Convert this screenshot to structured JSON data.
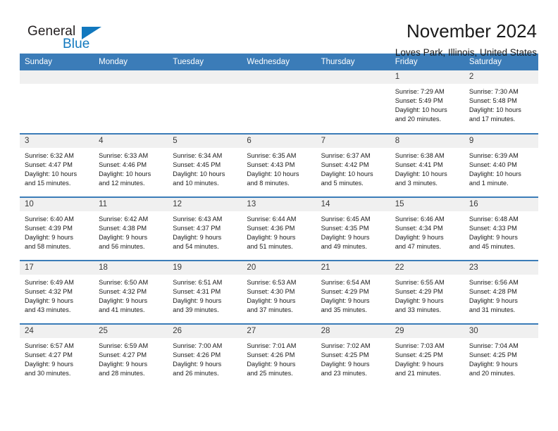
{
  "brand": {
    "name_part1": "General",
    "name_part2": "Blue",
    "triangle_color": "#1278be",
    "text_color": "#231f20"
  },
  "header": {
    "title": "November 2024",
    "subtitle": "Loves Park, Illinois, United States"
  },
  "theme": {
    "header_bg": "#3b7cb8",
    "header_text": "#ffffff",
    "daynum_band": "#f0f0f0",
    "cell_bg": "#ffffff",
    "rule_color": "#3b7cb8"
  },
  "weekday_headers": [
    "Sunday",
    "Monday",
    "Tuesday",
    "Wednesday",
    "Thursday",
    "Friday",
    "Saturday"
  ],
  "weeks": [
    [
      {
        "day": "",
        "sunrise": "",
        "sunset": "",
        "daylight_line1": "",
        "daylight_line2": "",
        "empty": true
      },
      {
        "day": "",
        "sunrise": "",
        "sunset": "",
        "daylight_line1": "",
        "daylight_line2": "",
        "empty": true
      },
      {
        "day": "",
        "sunrise": "",
        "sunset": "",
        "daylight_line1": "",
        "daylight_line2": "",
        "empty": true
      },
      {
        "day": "",
        "sunrise": "",
        "sunset": "",
        "daylight_line1": "",
        "daylight_line2": "",
        "empty": true
      },
      {
        "day": "",
        "sunrise": "",
        "sunset": "",
        "daylight_line1": "",
        "daylight_line2": "",
        "empty": true
      },
      {
        "day": "1",
        "sunrise": "Sunrise: 7:29 AM",
        "sunset": "Sunset: 5:49 PM",
        "daylight_line1": "Daylight: 10 hours",
        "daylight_line2": "and 20 minutes.",
        "empty": false
      },
      {
        "day": "2",
        "sunrise": "Sunrise: 7:30 AM",
        "sunset": "Sunset: 5:48 PM",
        "daylight_line1": "Daylight: 10 hours",
        "daylight_line2": "and 17 minutes.",
        "empty": false
      }
    ],
    [
      {
        "day": "3",
        "sunrise": "Sunrise: 6:32 AM",
        "sunset": "Sunset: 4:47 PM",
        "daylight_line1": "Daylight: 10 hours",
        "daylight_line2": "and 15 minutes.",
        "empty": false
      },
      {
        "day": "4",
        "sunrise": "Sunrise: 6:33 AM",
        "sunset": "Sunset: 4:46 PM",
        "daylight_line1": "Daylight: 10 hours",
        "daylight_line2": "and 12 minutes.",
        "empty": false
      },
      {
        "day": "5",
        "sunrise": "Sunrise: 6:34 AM",
        "sunset": "Sunset: 4:45 PM",
        "daylight_line1": "Daylight: 10 hours",
        "daylight_line2": "and 10 minutes.",
        "empty": false
      },
      {
        "day": "6",
        "sunrise": "Sunrise: 6:35 AM",
        "sunset": "Sunset: 4:43 PM",
        "daylight_line1": "Daylight: 10 hours",
        "daylight_line2": "and 8 minutes.",
        "empty": false
      },
      {
        "day": "7",
        "sunrise": "Sunrise: 6:37 AM",
        "sunset": "Sunset: 4:42 PM",
        "daylight_line1": "Daylight: 10 hours",
        "daylight_line2": "and 5 minutes.",
        "empty": false
      },
      {
        "day": "8",
        "sunrise": "Sunrise: 6:38 AM",
        "sunset": "Sunset: 4:41 PM",
        "daylight_line1": "Daylight: 10 hours",
        "daylight_line2": "and 3 minutes.",
        "empty": false
      },
      {
        "day": "9",
        "sunrise": "Sunrise: 6:39 AM",
        "sunset": "Sunset: 4:40 PM",
        "daylight_line1": "Daylight: 10 hours",
        "daylight_line2": "and 1 minute.",
        "empty": false
      }
    ],
    [
      {
        "day": "10",
        "sunrise": "Sunrise: 6:40 AM",
        "sunset": "Sunset: 4:39 PM",
        "daylight_line1": "Daylight: 9 hours",
        "daylight_line2": "and 58 minutes.",
        "empty": false
      },
      {
        "day": "11",
        "sunrise": "Sunrise: 6:42 AM",
        "sunset": "Sunset: 4:38 PM",
        "daylight_line1": "Daylight: 9 hours",
        "daylight_line2": "and 56 minutes.",
        "empty": false
      },
      {
        "day": "12",
        "sunrise": "Sunrise: 6:43 AM",
        "sunset": "Sunset: 4:37 PM",
        "daylight_line1": "Daylight: 9 hours",
        "daylight_line2": "and 54 minutes.",
        "empty": false
      },
      {
        "day": "13",
        "sunrise": "Sunrise: 6:44 AM",
        "sunset": "Sunset: 4:36 PM",
        "daylight_line1": "Daylight: 9 hours",
        "daylight_line2": "and 51 minutes.",
        "empty": false
      },
      {
        "day": "14",
        "sunrise": "Sunrise: 6:45 AM",
        "sunset": "Sunset: 4:35 PM",
        "daylight_line1": "Daylight: 9 hours",
        "daylight_line2": "and 49 minutes.",
        "empty": false
      },
      {
        "day": "15",
        "sunrise": "Sunrise: 6:46 AM",
        "sunset": "Sunset: 4:34 PM",
        "daylight_line1": "Daylight: 9 hours",
        "daylight_line2": "and 47 minutes.",
        "empty": false
      },
      {
        "day": "16",
        "sunrise": "Sunrise: 6:48 AM",
        "sunset": "Sunset: 4:33 PM",
        "daylight_line1": "Daylight: 9 hours",
        "daylight_line2": "and 45 minutes.",
        "empty": false
      }
    ],
    [
      {
        "day": "17",
        "sunrise": "Sunrise: 6:49 AM",
        "sunset": "Sunset: 4:32 PM",
        "daylight_line1": "Daylight: 9 hours",
        "daylight_line2": "and 43 minutes.",
        "empty": false
      },
      {
        "day": "18",
        "sunrise": "Sunrise: 6:50 AM",
        "sunset": "Sunset: 4:32 PM",
        "daylight_line1": "Daylight: 9 hours",
        "daylight_line2": "and 41 minutes.",
        "empty": false
      },
      {
        "day": "19",
        "sunrise": "Sunrise: 6:51 AM",
        "sunset": "Sunset: 4:31 PM",
        "daylight_line1": "Daylight: 9 hours",
        "daylight_line2": "and 39 minutes.",
        "empty": false
      },
      {
        "day": "20",
        "sunrise": "Sunrise: 6:53 AM",
        "sunset": "Sunset: 4:30 PM",
        "daylight_line1": "Daylight: 9 hours",
        "daylight_line2": "and 37 minutes.",
        "empty": false
      },
      {
        "day": "21",
        "sunrise": "Sunrise: 6:54 AM",
        "sunset": "Sunset: 4:29 PM",
        "daylight_line1": "Daylight: 9 hours",
        "daylight_line2": "and 35 minutes.",
        "empty": false
      },
      {
        "day": "22",
        "sunrise": "Sunrise: 6:55 AM",
        "sunset": "Sunset: 4:29 PM",
        "daylight_line1": "Daylight: 9 hours",
        "daylight_line2": "and 33 minutes.",
        "empty": false
      },
      {
        "day": "23",
        "sunrise": "Sunrise: 6:56 AM",
        "sunset": "Sunset: 4:28 PM",
        "daylight_line1": "Daylight: 9 hours",
        "daylight_line2": "and 31 minutes.",
        "empty": false
      }
    ],
    [
      {
        "day": "24",
        "sunrise": "Sunrise: 6:57 AM",
        "sunset": "Sunset: 4:27 PM",
        "daylight_line1": "Daylight: 9 hours",
        "daylight_line2": "and 30 minutes.",
        "empty": false
      },
      {
        "day": "25",
        "sunrise": "Sunrise: 6:59 AM",
        "sunset": "Sunset: 4:27 PM",
        "daylight_line1": "Daylight: 9 hours",
        "daylight_line2": "and 28 minutes.",
        "empty": false
      },
      {
        "day": "26",
        "sunrise": "Sunrise: 7:00 AM",
        "sunset": "Sunset: 4:26 PM",
        "daylight_line1": "Daylight: 9 hours",
        "daylight_line2": "and 26 minutes.",
        "empty": false
      },
      {
        "day": "27",
        "sunrise": "Sunrise: 7:01 AM",
        "sunset": "Sunset: 4:26 PM",
        "daylight_line1": "Daylight: 9 hours",
        "daylight_line2": "and 25 minutes.",
        "empty": false
      },
      {
        "day": "28",
        "sunrise": "Sunrise: 7:02 AM",
        "sunset": "Sunset: 4:25 PM",
        "daylight_line1": "Daylight: 9 hours",
        "daylight_line2": "and 23 minutes.",
        "empty": false
      },
      {
        "day": "29",
        "sunrise": "Sunrise: 7:03 AM",
        "sunset": "Sunset: 4:25 PM",
        "daylight_line1": "Daylight: 9 hours",
        "daylight_line2": "and 21 minutes.",
        "empty": false
      },
      {
        "day": "30",
        "sunrise": "Sunrise: 7:04 AM",
        "sunset": "Sunset: 4:25 PM",
        "daylight_line1": "Daylight: 9 hours",
        "daylight_line2": "and 20 minutes.",
        "empty": false
      }
    ]
  ]
}
